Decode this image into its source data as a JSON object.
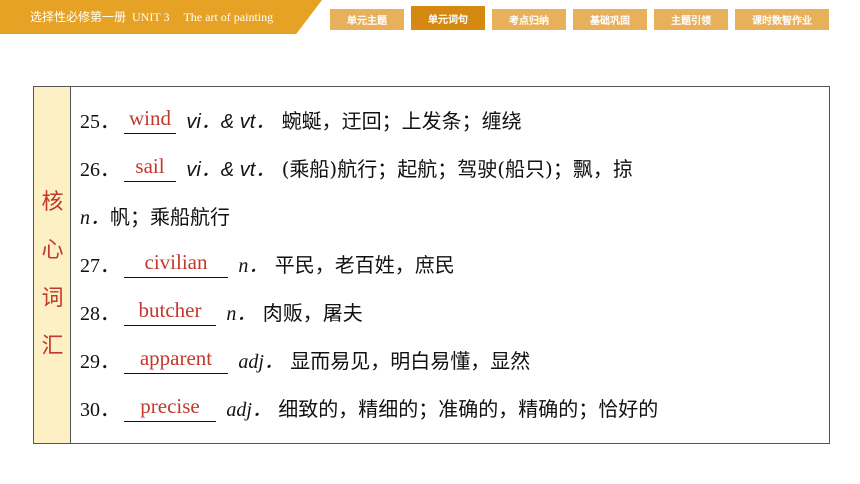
{
  "header": {
    "title_cn": "选择性必修第一册",
    "title_unit": "UNIT 3",
    "title_name": "The art of painting",
    "tabs": [
      {
        "label": "单元主题",
        "active": false
      },
      {
        "label": "单元词句",
        "active": true
      },
      {
        "label": "考点归纳",
        "active": false
      },
      {
        "label": "基础巩固",
        "active": false
      },
      {
        "label": "主题引领",
        "active": false
      },
      {
        "label": "课时数智作业",
        "active": false
      }
    ]
  },
  "side_label": [
    "核",
    "心",
    "词",
    "汇"
  ],
  "items": [
    {
      "num": "25．",
      "answer": "wind",
      "pos": "vi．& vt．",
      "meaning": "蜿蜒，迂回；上发条；缠绕"
    },
    {
      "num": "26．",
      "answer": "sail",
      "pos": "vi．& vt．",
      "meaning": "(乘船)航行；起航；驾驶(船只)；飘，掠"
    },
    {
      "continuation_pos": "n．",
      "continuation": "帆；乘船航行"
    },
    {
      "num": "27．",
      "answer": "civilian",
      "pos": "n．",
      "meaning": "平民，老百姓，庶民"
    },
    {
      "num": "28．",
      "answer": "butcher",
      "pos": "n．",
      "meaning": "肉贩，屠夫"
    },
    {
      "num": "29．",
      "answer": "apparent",
      "pos": "adj．",
      "meaning": "显而易见，明白易懂，显然"
    },
    {
      "num": "30．",
      "answer": "precise",
      "pos": "adj．",
      "meaning": "细致的，精细的；准确的，精确的；恰好的"
    }
  ],
  "colors": {
    "accent": "#e6a224",
    "answer": "#c0392b",
    "side_bg": "#fdf0c5"
  }
}
